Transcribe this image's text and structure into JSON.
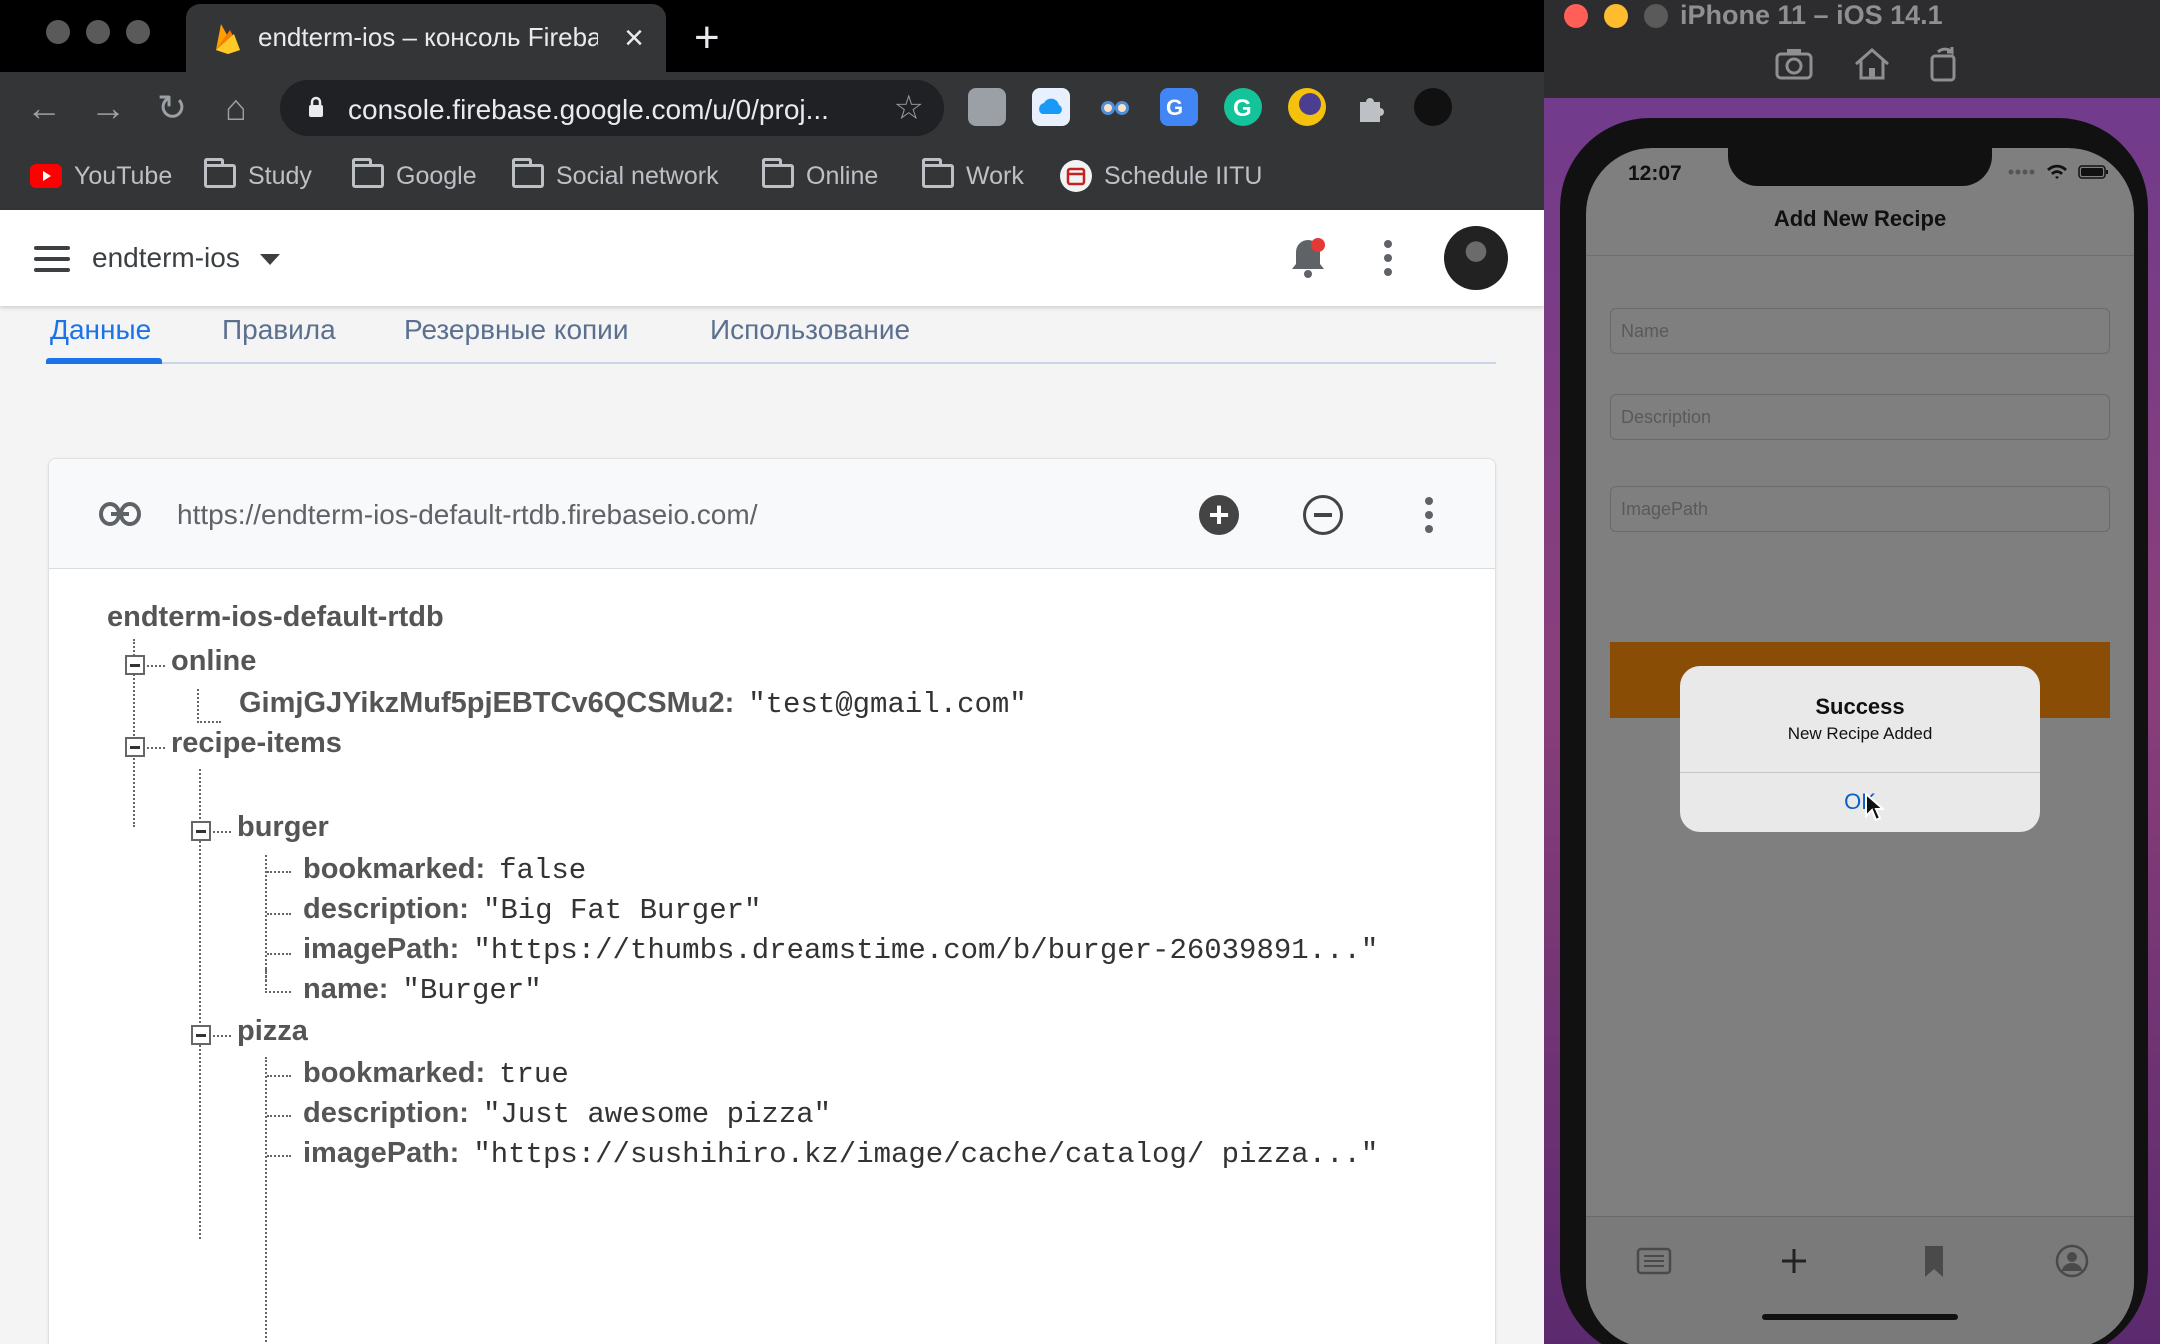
{
  "browser": {
    "tab_title": "endterm-ios – консоль Firebase",
    "url": "console.firebase.google.com/u/0/proj...",
    "bookmarks": [
      "YouTube",
      "Study",
      "Google",
      "Social network",
      "Online",
      "Work",
      "Schedule IITU"
    ]
  },
  "firebase": {
    "project": "endterm-ios",
    "tabs": [
      "Данные",
      "Правила",
      "Резервные копии",
      "Использование"
    ],
    "db_url": "https://endterm-ios-default-rtdb.firebaseio.com/",
    "root": "endterm-ios-default-rtdb",
    "tree": {
      "online": "online",
      "online_key": "GimjGJYikzMuf5pjEBTCv6QCSMu2:",
      "online_val": "\"test@gmail.com\"",
      "recipe_items": "recipe-items",
      "burger": "burger",
      "burger_bookmarked_k": "bookmarked:",
      "burger_bookmarked_v": "false",
      "burger_description_k": "description:",
      "burger_description_v": "\"Big Fat Burger\"",
      "burger_image_k": "imagePath:",
      "burger_image_v": "\"https://thumbs.dreamstime.com/b/burger-26039891...\"",
      "burger_name_k": "name:",
      "burger_name_v": "\"Burger\"",
      "pizza": "pizza",
      "pizza_bookmarked_k": "bookmarked:",
      "pizza_bookmarked_v": "true",
      "pizza_description_k": "description:",
      "pizza_description_v": "\"Just awesome pizza\"",
      "pizza_image_k": "imagePath:",
      "pizza_image_v": "\"https://sushihiro.kz/image/cache/catalog/ pizza...\""
    }
  },
  "simulator": {
    "title": "iPhone 11 – iOS 14.1",
    "time": "12:07",
    "nav_title": "Add New Recipe",
    "fields": {
      "name": "Name",
      "description": "Description",
      "image": "ImagePath"
    },
    "alert": {
      "title": "Success",
      "message": "New Recipe Added",
      "ok": "OK"
    }
  },
  "colors": {
    "firebase_blue": "#1a73e8",
    "alert_button": "#0a60c8",
    "orange_button": "#8a4d06"
  }
}
